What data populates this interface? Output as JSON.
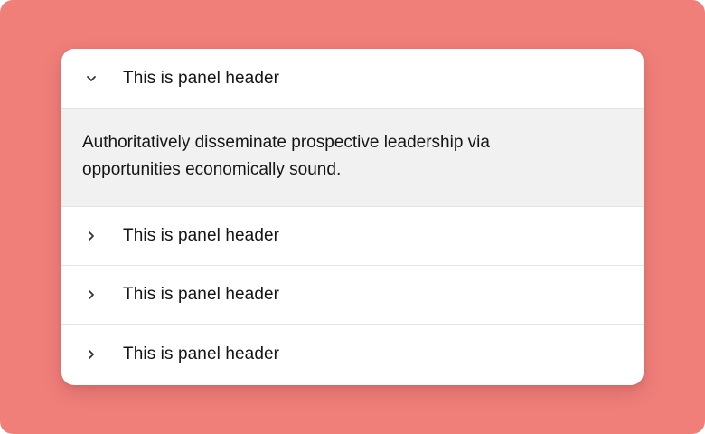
{
  "accordion": {
    "panels": [
      {
        "header": "This is panel header",
        "expanded": true,
        "icon": "chevron-down-icon",
        "content": "Authoritatively disseminate prospective leadership via opportunities economically sound."
      },
      {
        "header": "This is panel header",
        "expanded": false,
        "icon": "chevron-right-icon"
      },
      {
        "header": "This is panel header",
        "expanded": false,
        "icon": "chevron-right-icon"
      },
      {
        "header": "This is panel header",
        "expanded": false,
        "icon": "chevron-right-icon"
      }
    ]
  },
  "colors": {
    "background": "#F07F7A",
    "card": "#FFFFFF",
    "expanded_body": "#F1F1F1",
    "divider": "#E3E3E3",
    "text": "#151515"
  }
}
